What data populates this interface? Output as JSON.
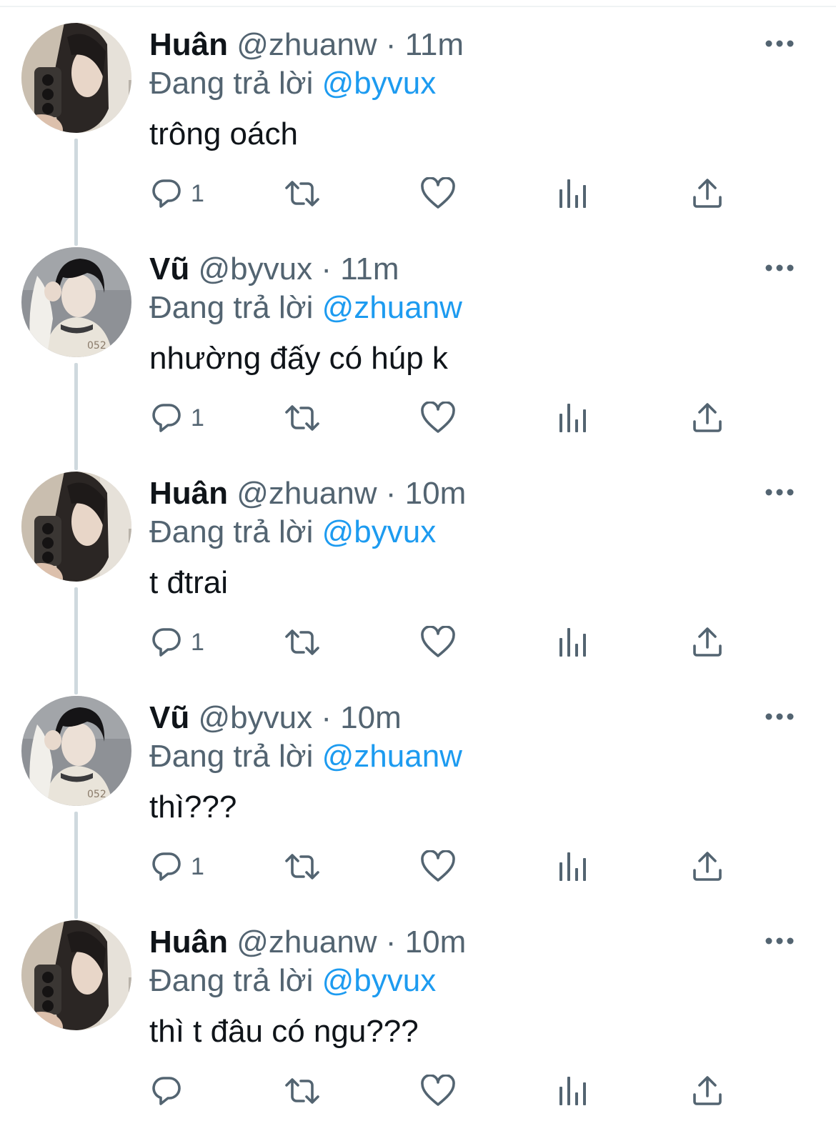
{
  "tweets": [
    {
      "name": "Huân",
      "handle": "@zhuanw",
      "sep": "·",
      "time": "11m",
      "replying_prefix": "Đang trả lời",
      "replying_to": "@byvux",
      "text": "trông oách",
      "reply_count": "1",
      "avatar": "huan"
    },
    {
      "name": "Vũ",
      "handle": "@byvux",
      "sep": "·",
      "time": "11m",
      "replying_prefix": "Đang trả lời",
      "replying_to": "@zhuanw",
      "text": "nhường đấy có húp k",
      "reply_count": "1",
      "avatar": "vu"
    },
    {
      "name": "Huân",
      "handle": "@zhuanw",
      "sep": "·",
      "time": "10m",
      "replying_prefix": "Đang trả lời",
      "replying_to": "@byvux",
      "text": "t đtrai",
      "reply_count": "1",
      "avatar": "huan"
    },
    {
      "name": "Vũ",
      "handle": "@byvux",
      "sep": "·",
      "time": "10m",
      "replying_prefix": "Đang trả lời",
      "replying_to": "@zhuanw",
      "text": "thì???",
      "reply_count": "1",
      "avatar": "vu"
    },
    {
      "name": "Huân",
      "handle": "@zhuanw",
      "sep": "·",
      "time": "10m",
      "replying_prefix": "Đang trả lời",
      "replying_to": "@byvux",
      "text": "thì t đâu có ngu???",
      "reply_count": "",
      "avatar": "huan"
    }
  ],
  "icons": {
    "reply": "reply-icon",
    "retweet": "retweet-icon",
    "like": "like-icon",
    "views": "views-icon",
    "share": "share-icon",
    "more": "more-icon"
  },
  "colors": {
    "text": "#0f1419",
    "secondary": "#536471",
    "mention": "#1d9bf0",
    "icon": "#536471",
    "thread_line": "#cfd9de"
  }
}
